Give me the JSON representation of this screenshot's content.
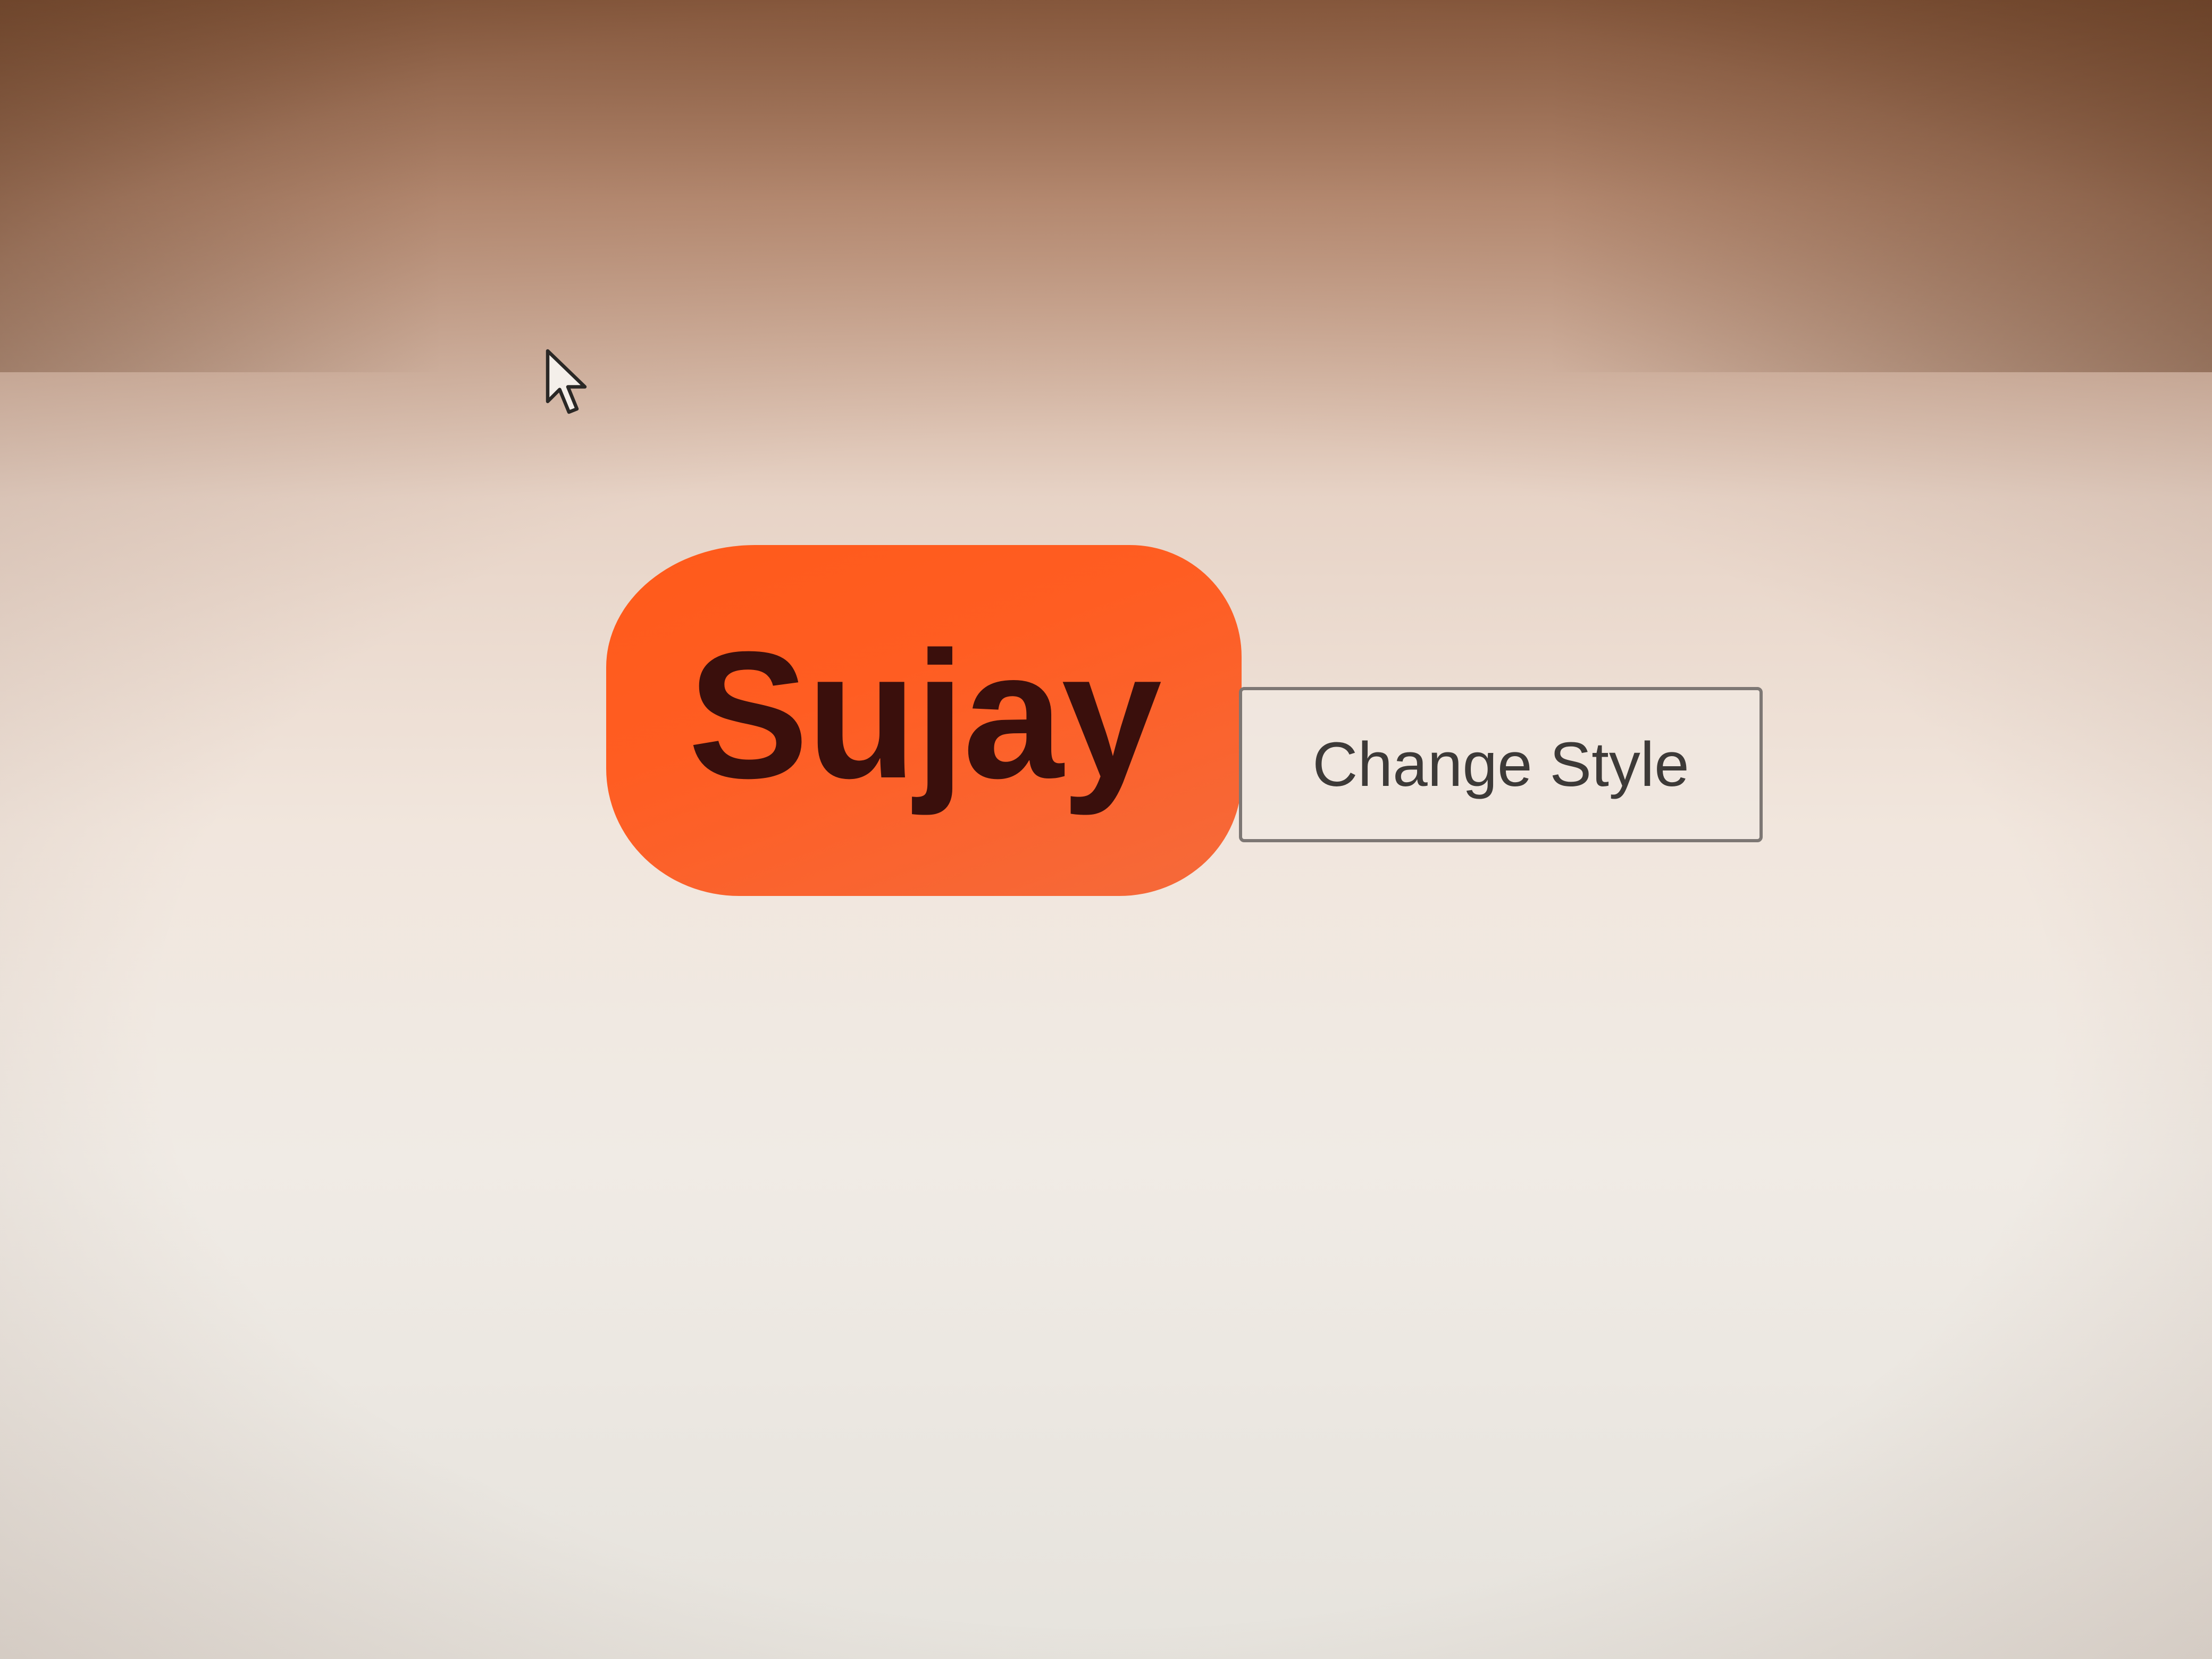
{
  "badge": {
    "name": "Sujay",
    "background_color": "#ff5a1a",
    "text_color": "#3a0f0c"
  },
  "button": {
    "label": "Change Style"
  },
  "cursor": {
    "icon": "arrow-cursor-icon"
  }
}
